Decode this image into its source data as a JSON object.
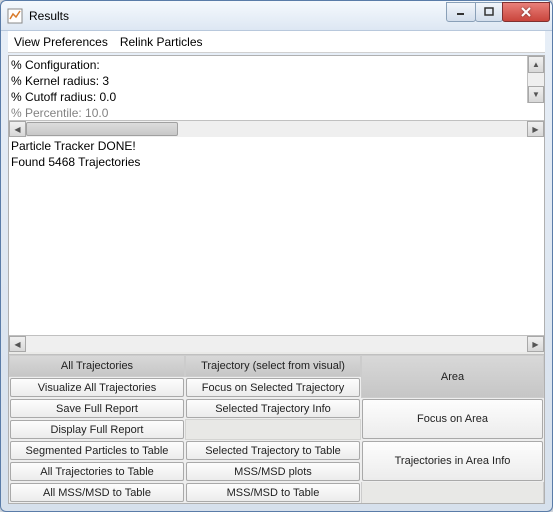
{
  "window": {
    "title": "Results"
  },
  "menu": {
    "view_prefs": "View Preferences",
    "relink": "Relink Particles"
  },
  "pane1": {
    "line1": "% Configuration:",
    "line2": "% Kernel radius: 3",
    "line3": "% Cutoff radius: 0.0",
    "line4": "% Percentile: 10.0"
  },
  "pane2": {
    "line1": "Particle Tracker DONE!",
    "line2": "Found 5468 Trajectories"
  },
  "headers": {
    "col1": "All Trajectories",
    "col2": "Trajectory (select from visual)",
    "col3": "Area"
  },
  "buttons": {
    "r1c1": "Visualize All Trajectories",
    "r1c2": "Focus on Selected Trajectory",
    "r2c1": "Save Full Report",
    "r2c2": "Selected Trajectory Info",
    "r2c3": "Focus on Area",
    "r3c1": "Display Full Report",
    "r4c1": "Segmented Particles to Table",
    "r4c2": "Selected Trajectory to Table",
    "r4c3": "Trajectories in Area Info",
    "r5c1": "All Trajectories to Table",
    "r5c2": "MSS/MSD plots",
    "r6c1": "All MSS/MSD to Table",
    "r6c2": "MSS/MSD to Table"
  }
}
